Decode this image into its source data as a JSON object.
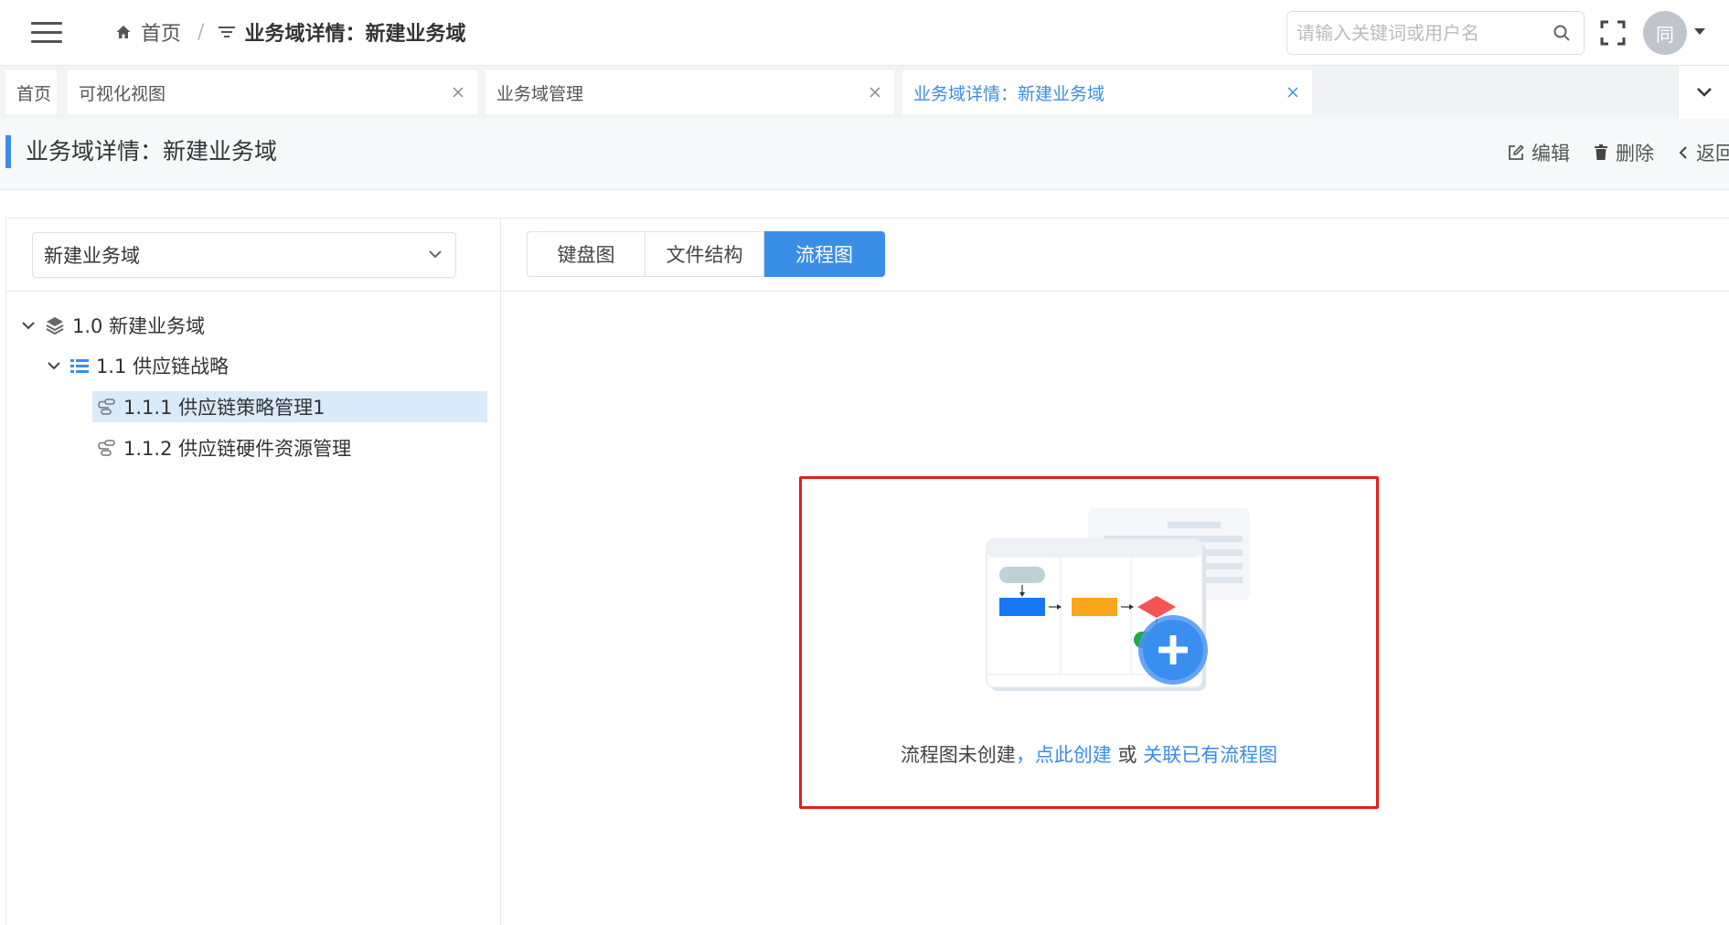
{
  "header": {
    "home_label": "首页",
    "separator": "/",
    "current_label": "业务域详情：新建业务域",
    "search_placeholder": "请输入关键词或用户名",
    "avatar_text": "同"
  },
  "tabs": [
    {
      "label": "首页",
      "closable": false,
      "active": false
    },
    {
      "label": "可视化视图",
      "closable": true,
      "active": false
    },
    {
      "label": "业务域管理",
      "closable": true,
      "active": false
    },
    {
      "label": "业务域详情：新建业务域",
      "closable": true,
      "active": true
    }
  ],
  "page": {
    "title": "业务域详情：新建业务域",
    "actions": {
      "edit": "编辑",
      "delete": "删除",
      "back": "返回"
    }
  },
  "sidebar": {
    "select_value": "新建业务域",
    "tree": [
      {
        "label": "1.0 新建业务域",
        "level": 0,
        "icon": "layers-icon",
        "expanded": true,
        "selected": false
      },
      {
        "label": "1.1 供应链战略",
        "level": 1,
        "icon": "list-icon",
        "expanded": true,
        "selected": false
      },
      {
        "label": "1.1.1 供应链策略管理1",
        "level": 2,
        "icon": "process-icon",
        "selected": true
      },
      {
        "label": "1.1.2 供应链硬件资源管理",
        "level": 2,
        "icon": "process-icon",
        "selected": false
      }
    ]
  },
  "view_tabs": [
    {
      "label": "键盘图",
      "active": false
    },
    {
      "label": "文件结构",
      "active": false
    },
    {
      "label": "流程图",
      "active": true
    }
  ],
  "empty_state": {
    "prefix": "流程图未创建",
    "comma": "，",
    "create_link": "点此创建",
    "or": " 或 ",
    "link_existing": "关联已有流程图"
  },
  "colors": {
    "accent": "#3a8ee6",
    "highlight_border": "#e02020",
    "selected_row": "#d9eafb"
  }
}
